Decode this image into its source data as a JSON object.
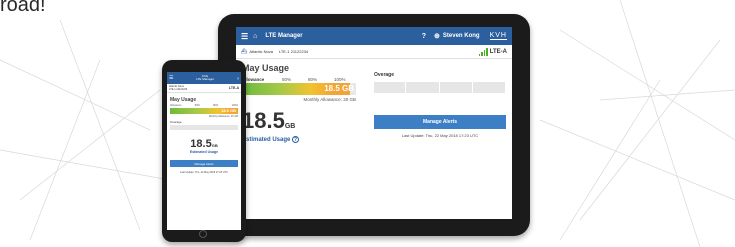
{
  "headline_fragment": "road!",
  "tablet": {
    "header": {
      "menu_icon": "menu-icon",
      "home_icon": "home-icon",
      "app_title": "LTE Manager",
      "help_icon": "help-icon",
      "user_icon": "user-icon",
      "user_name": "Steven Kong",
      "logo_text": "KVH"
    },
    "subheader": {
      "vessel": "Atlantic Nova",
      "terminal": "LTE-1 21122234",
      "network": "LTE-A"
    },
    "usage": {
      "title": "May Usage",
      "allowance_label": "Allowance",
      "scale": [
        "50%",
        "80%",
        "100%"
      ],
      "bar_value": "18.5 GB",
      "monthly_allowance": "Monthly Allowance: 20 GB",
      "big_number": "18.5",
      "big_unit": "GB",
      "estimated_label": "Estimated Usage"
    },
    "overage": {
      "label": "Overage"
    },
    "manage_alerts": "Manage Alerts",
    "last_update": "Last Update: Thu, 22 May 2018 17:23 UTC"
  },
  "phone": {
    "header": {
      "logo_text": "KVH",
      "app_title": "LTE Manager"
    },
    "subheader": {
      "vessel": "Atlantic Nova",
      "terminal": "LTE-1 21122234",
      "network": "LTE-A"
    },
    "usage": {
      "title": "May Usage",
      "allowance_label": "Allowance",
      "scale": [
        "50%",
        "80%",
        "100%"
      ],
      "bar_value": "18.5 GB",
      "monthly_allowance": "Monthly Allowance: 20 GB",
      "big_number": "18.5",
      "big_unit": "GB",
      "estimated_label": "Estimated Usage"
    },
    "overage": {
      "label": "Overage"
    },
    "manage_alerts": "Manage Alerts",
    "last_update": "Last Update: Thu, 22 May 2018 17:23 UTC"
  },
  "colors": {
    "header_blue": "#2c5f9e",
    "button_blue": "#3d7fc4",
    "signal_green": "#4caf2a"
  }
}
